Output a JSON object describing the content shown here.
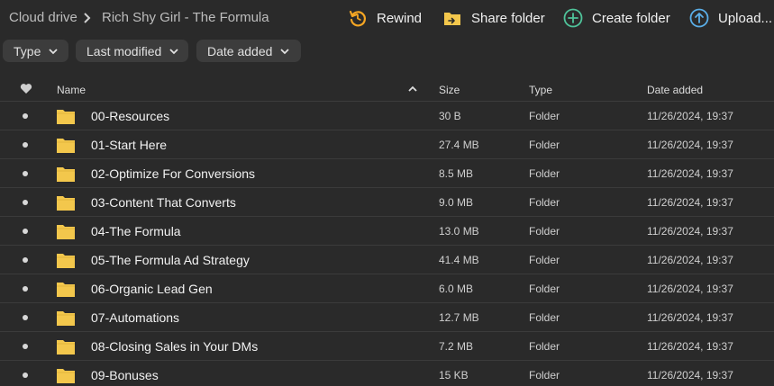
{
  "breadcrumb": {
    "root": "Cloud drive",
    "current": "Rich Shy Girl - The Formula"
  },
  "actions": {
    "rewind": "Rewind",
    "share_folder": "Share folder",
    "create_folder": "Create folder",
    "upload": "Upload..."
  },
  "filters": {
    "type": "Type",
    "last_modified": "Last modified",
    "date_added": "Date added"
  },
  "columns": {
    "name": "Name",
    "size": "Size",
    "type": "Type",
    "date_added": "Date added"
  },
  "colors": {
    "background": "#2a2a2a",
    "folder": "#f3c74c",
    "rewind_icon": "#f5a623",
    "share_icon": "#f3c74c",
    "create_icon": "#4fc39a",
    "upload_icon": "#5aaee8"
  },
  "rows": [
    {
      "name": "00-Resources",
      "size": "30 B",
      "type": "Folder",
      "date": "11/26/2024, 19:37"
    },
    {
      "name": "01-Start Here",
      "size": "27.4 MB",
      "type": "Folder",
      "date": "11/26/2024, 19:37"
    },
    {
      "name": "02-Optimize For Conversions",
      "size": "8.5 MB",
      "type": "Folder",
      "date": "11/26/2024, 19:37"
    },
    {
      "name": "03-Content That Converts",
      "size": "9.0 MB",
      "type": "Folder",
      "date": "11/26/2024, 19:37"
    },
    {
      "name": "04-The Formula",
      "size": "13.0 MB",
      "type": "Folder",
      "date": "11/26/2024, 19:37"
    },
    {
      "name": "05-The Formula Ad Strategy",
      "size": "41.4 MB",
      "type": "Folder",
      "date": "11/26/2024, 19:37"
    },
    {
      "name": "06-Organic Lead Gen",
      "size": "6.0 MB",
      "type": "Folder",
      "date": "11/26/2024, 19:37"
    },
    {
      "name": "07-Automations",
      "size": "12.7 MB",
      "type": "Folder",
      "date": "11/26/2024, 19:37"
    },
    {
      "name": "08-Closing Sales in Your DMs",
      "size": "7.2 MB",
      "type": "Folder",
      "date": "11/26/2024, 19:37"
    },
    {
      "name": "09-Bonuses",
      "size": "15 KB",
      "type": "Folder",
      "date": "11/26/2024, 19:37"
    }
  ]
}
